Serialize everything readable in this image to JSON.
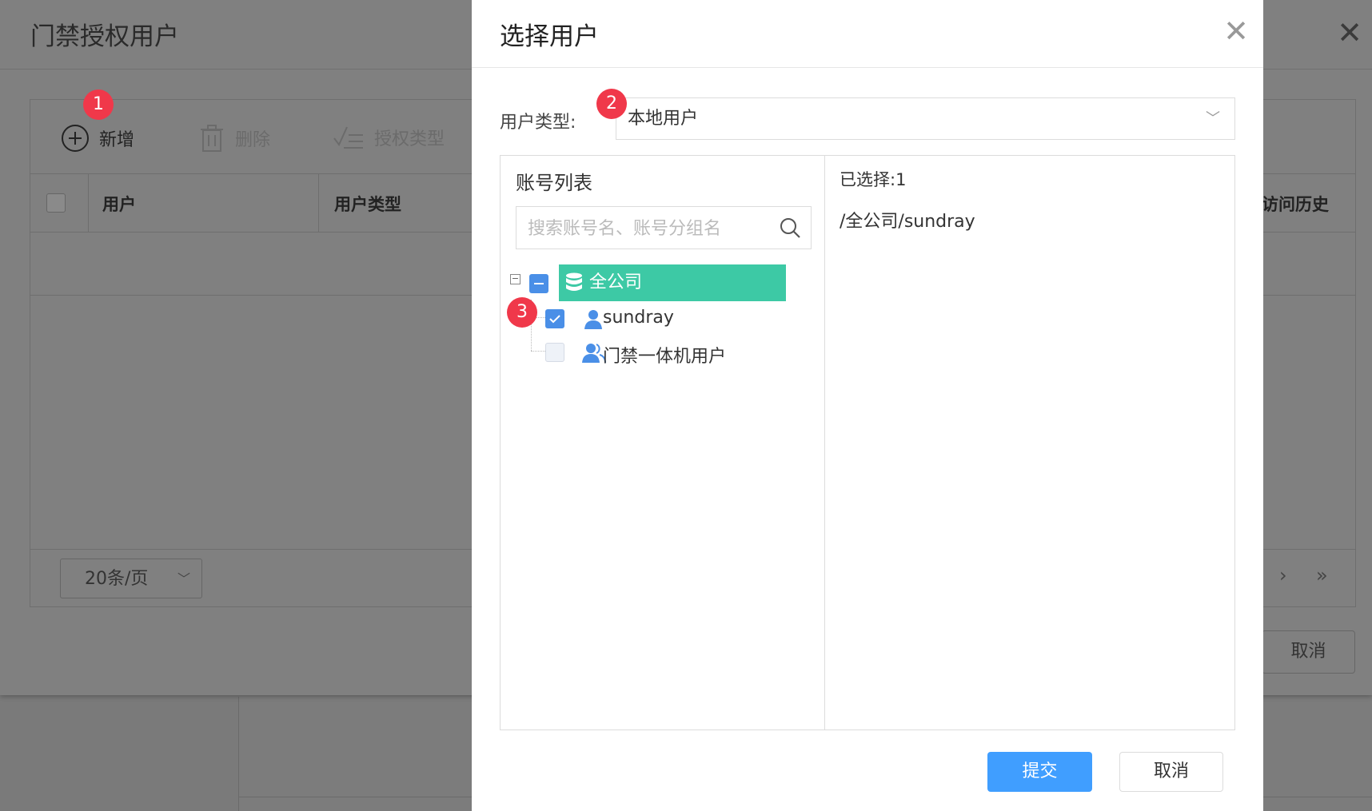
{
  "background": {
    "title": "门禁授权用户",
    "toolbar": {
      "add_label": "新增",
      "delete_label": "删除",
      "auth_type_label": "授权类型"
    },
    "table": {
      "columns": [
        "用户",
        "用户类型",
        "访问历史"
      ]
    },
    "page_size": "20条/页",
    "cancel_label": "取消"
  },
  "modal": {
    "title": "选择用户",
    "user_type_label": "用户类型:",
    "user_type_value": "本地用户",
    "account_list_title": "账号列表",
    "search_placeholder": "搜索账号名、账号分组名",
    "tree": {
      "root": {
        "label": "全公司",
        "checked": "partial"
      },
      "children": [
        {
          "label": "sundray",
          "checked": true,
          "icon": "user-icon"
        },
        {
          "label": "门禁一体机用户",
          "checked": false,
          "icon": "user-group-icon"
        }
      ]
    },
    "selected_count": "已选择:1",
    "selected_items": [
      "/全公司/sundray"
    ],
    "submit_label": "提交",
    "cancel_label": "取消"
  },
  "annotations": [
    "1",
    "2",
    "3"
  ],
  "colors": {
    "primary": "#409eff",
    "selected_node": "#3dc9a5",
    "badge": "#f0384a"
  }
}
